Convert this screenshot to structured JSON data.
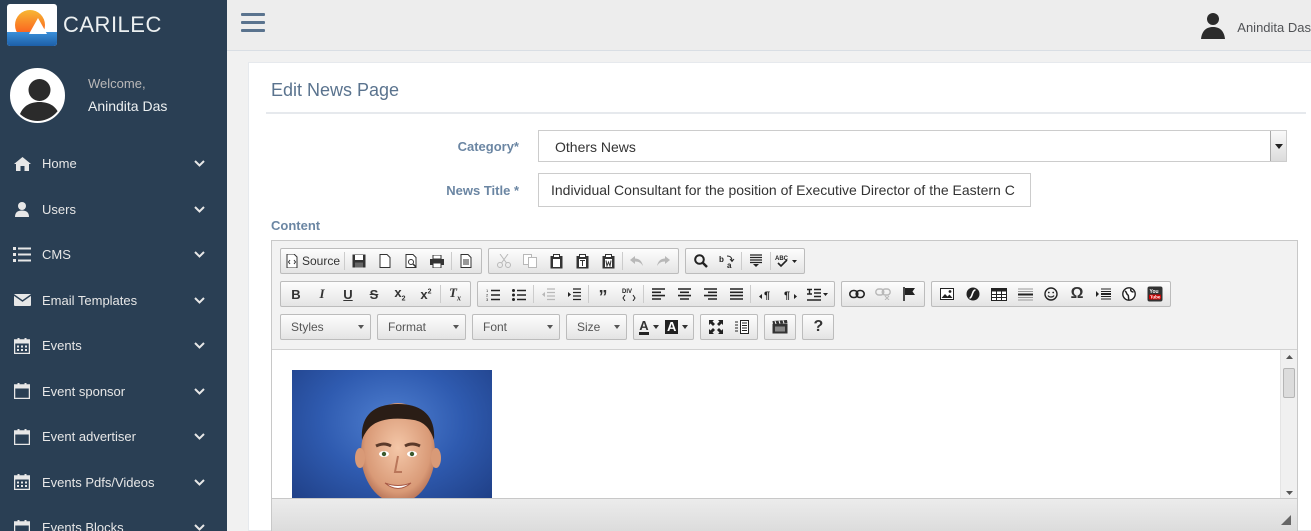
{
  "brand": {
    "title": "CARILEC"
  },
  "profile": {
    "welcome": "Welcome,",
    "name": "Anindita Das"
  },
  "sidebar": {
    "items": [
      {
        "label": "Home",
        "icon": "home-icon"
      },
      {
        "label": "Users",
        "icon": "user-icon"
      },
      {
        "label": "CMS",
        "icon": "list-icon"
      },
      {
        "label": "Email Templates",
        "icon": "envelope-icon"
      },
      {
        "label": "Events",
        "icon": "calendar-icon"
      },
      {
        "label": "Event sponsor",
        "icon": "calendar-icon"
      },
      {
        "label": "Event advertiser",
        "icon": "calendar-icon"
      },
      {
        "label": "Events Pdfs/Videos",
        "icon": "calendar-icon"
      },
      {
        "label": "Events Blocks",
        "icon": "calendar-icon"
      }
    ]
  },
  "topbar": {
    "user_name": "Anindita Das"
  },
  "page": {
    "title": "Edit News Page",
    "category_label": "Category*",
    "category_value": "Others News",
    "news_title_label": "News Title *",
    "news_title_value": "Individual Consultant for the position of Executive Director of the Eastern C",
    "content_label": "Content"
  },
  "editor": {
    "source_label": "Source",
    "combos": {
      "styles": "Styles",
      "format": "Format",
      "font": "Font",
      "size": "Size"
    }
  },
  "colors": {
    "sidebar_bg": "#2a3f54",
    "accent_label": "#6b86a3",
    "title": "#5a738e"
  }
}
